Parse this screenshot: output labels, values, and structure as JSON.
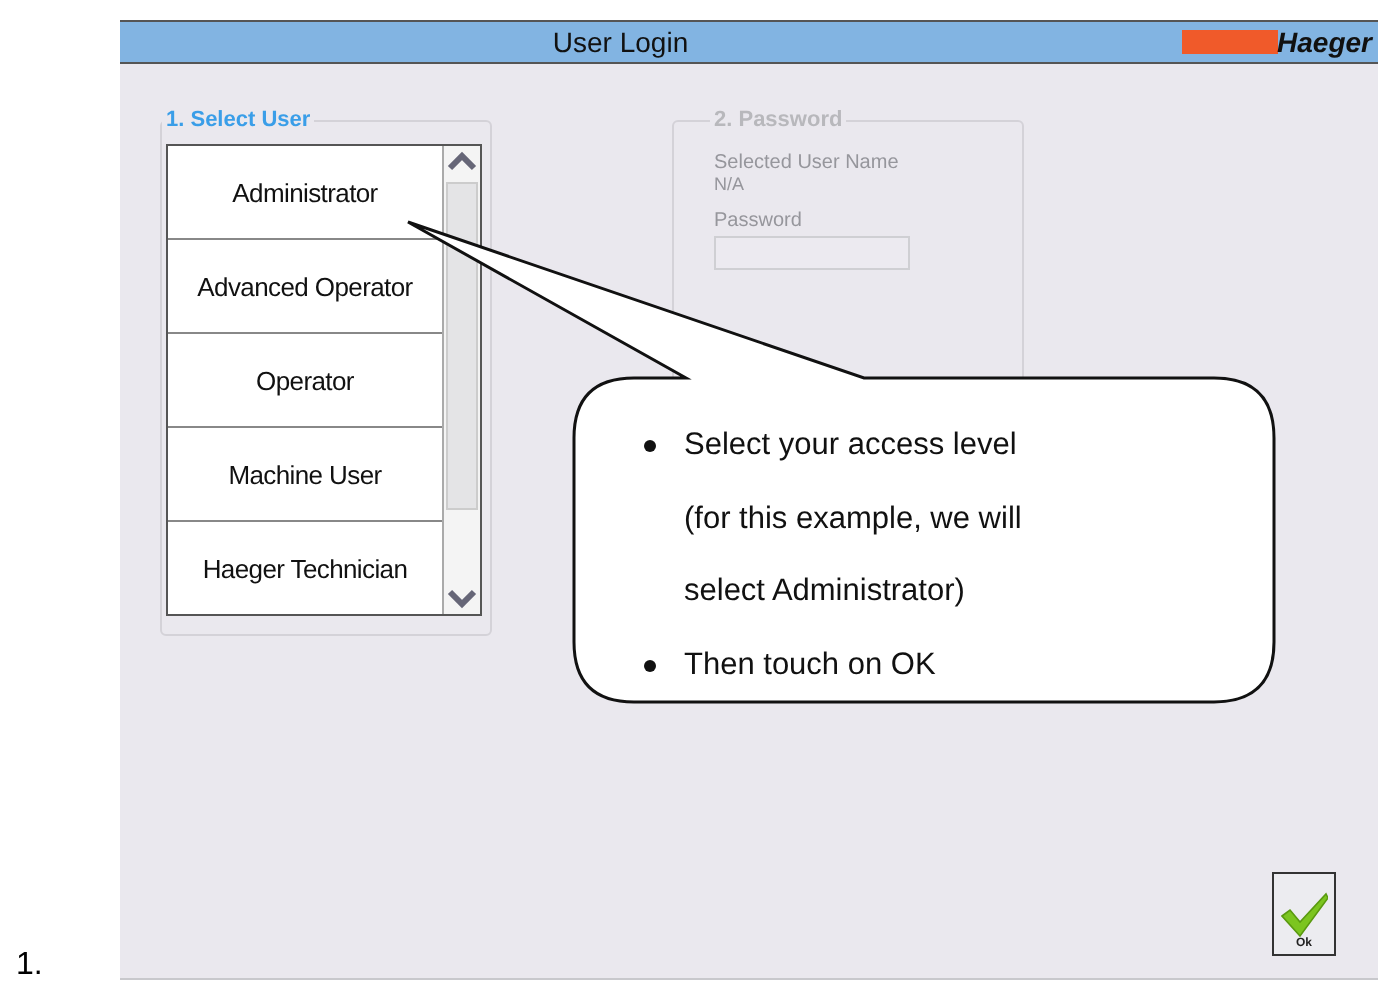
{
  "figure_number": "1.",
  "window": {
    "title": "User Login",
    "logo": "Haeger"
  },
  "select_user": {
    "legend": "1. Select User",
    "users": [
      "Administrator",
      "Advanced Operator",
      "Operator",
      "Machine User",
      "Haeger Technician"
    ]
  },
  "password_group": {
    "legend": "2. Password",
    "disabled": true,
    "selected_user_label": "Selected User Name",
    "selected_user_value": "N/A",
    "password_label": "Password"
  },
  "callout": {
    "bullets": [
      {
        "lines": [
          "Select your access level",
          "(for this example, we will",
          "select Administrator)"
        ]
      },
      {
        "lines": [
          "Then touch on OK"
        ]
      }
    ]
  },
  "ok_button": {
    "label": "Ok"
  }
}
